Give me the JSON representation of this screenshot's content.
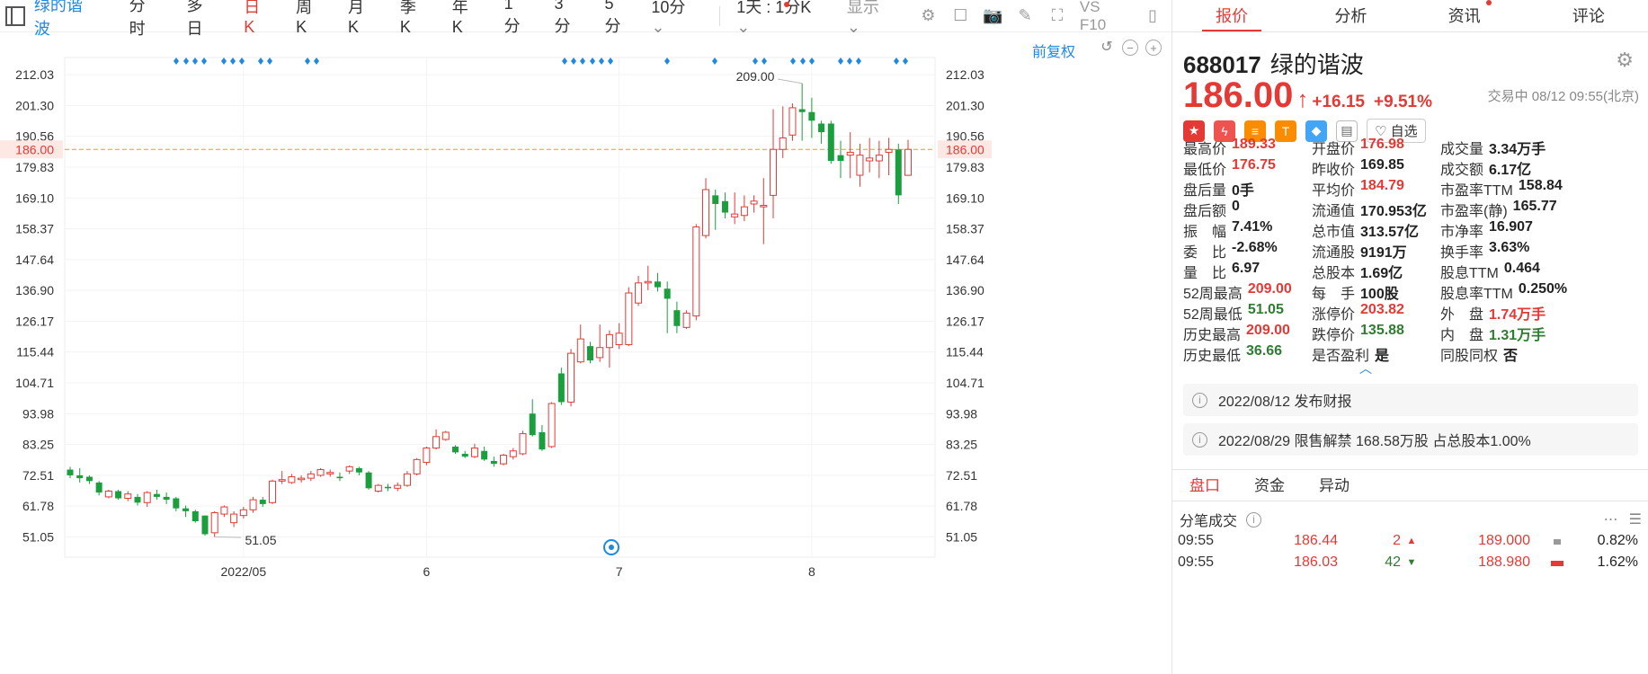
{
  "toolbar": {
    "stock_name": "绿的谐波",
    "tabs": [
      "分时",
      "多日",
      "日K",
      "周K",
      "月K",
      "季K",
      "年K",
      "1分",
      "3分",
      "5分",
      "10分"
    ],
    "active_tab": "日K",
    "period_dropdown": "1天 : 1分K",
    "display_dropdown": "显示",
    "f10_label": "VS F10"
  },
  "chart_controls": {
    "restore": "前复权"
  },
  "chart_data": {
    "type": "candlestick",
    "y_ticks": [
      "212.03",
      "201.30",
      "190.56",
      "179.83",
      "169.10",
      "158.37",
      "147.64",
      "136.90",
      "126.17",
      "115.44",
      "104.71",
      "93.98",
      "83.25",
      "72.51",
      "61.78",
      "51.05"
    ],
    "ylim": [
      44,
      218
    ],
    "x_ticks": [
      {
        "label": "2022/05",
        "index": 18
      },
      {
        "label": "6",
        "index": 37
      },
      {
        "label": "7",
        "index": 57
      },
      {
        "label": "8",
        "index": 77
      }
    ],
    "current_price": 186.0,
    "high_annotation": {
      "label": "209.00",
      "index": 76
    },
    "low_annotation": {
      "label": "51.05",
      "index": 15
    },
    "candles": [
      {
        "o": 74.5,
        "c": 72.5,
        "h": 75.5,
        "l": 71.5
      },
      {
        "o": 72.5,
        "c": 71.5,
        "h": 75.0,
        "l": 70.0
      },
      {
        "o": 72.0,
        "c": 70.5,
        "h": 72.5,
        "l": 69.5
      },
      {
        "o": 70.0,
        "c": 66.5,
        "h": 70.5,
        "l": 65.5
      },
      {
        "o": 65.0,
        "c": 67.0,
        "h": 67.5,
        "l": 64.5
      },
      {
        "o": 67.0,
        "c": 64.5,
        "h": 67.5,
        "l": 64.0
      },
      {
        "o": 64.5,
        "c": 66.0,
        "h": 67.0,
        "l": 63.5
      },
      {
        "o": 65.0,
        "c": 63.0,
        "h": 66.0,
        "l": 62.0
      },
      {
        "o": 63.0,
        "c": 66.5,
        "h": 67.0,
        "l": 61.5
      },
      {
        "o": 66.0,
        "c": 65.0,
        "h": 67.5,
        "l": 64.0
      },
      {
        "o": 65.0,
        "c": 64.0,
        "h": 66.5,
        "l": 62.5
      },
      {
        "o": 64.5,
        "c": 61.0,
        "h": 65.0,
        "l": 60.0
      },
      {
        "o": 61.0,
        "c": 60.0,
        "h": 62.0,
        "l": 58.0
      },
      {
        "o": 60.0,
        "c": 56.5,
        "h": 60.5,
        "l": 56.0
      },
      {
        "o": 58.5,
        "c": 52.0,
        "h": 58.5,
        "l": 51.5
      },
      {
        "o": 52.5,
        "c": 59.5,
        "h": 60.0,
        "l": 51.05
      },
      {
        "o": 59.0,
        "c": 61.5,
        "h": 62.0,
        "l": 58.0
      },
      {
        "o": 56.0,
        "c": 59.0,
        "h": 60.0,
        "l": 54.5
      },
      {
        "o": 58.5,
        "c": 60.5,
        "h": 61.5,
        "l": 57.5
      },
      {
        "o": 60.5,
        "c": 64.0,
        "h": 65.0,
        "l": 59.5
      },
      {
        "o": 64.0,
        "c": 62.5,
        "h": 65.0,
        "l": 61.5
      },
      {
        "o": 63.0,
        "c": 70.5,
        "h": 71.0,
        "l": 62.5
      },
      {
        "o": 70.5,
        "c": 71.0,
        "h": 74.0,
        "l": 69.5
      },
      {
        "o": 70.0,
        "c": 72.0,
        "h": 73.0,
        "l": 69.5
      },
      {
        "o": 71.0,
        "c": 71.5,
        "h": 72.5,
        "l": 70.0
      },
      {
        "o": 71.5,
        "c": 73.0,
        "h": 74.0,
        "l": 70.5
      },
      {
        "o": 72.5,
        "c": 74.5,
        "h": 75.0,
        "l": 72.0
      },
      {
        "o": 73.0,
        "c": 73.5,
        "h": 74.5,
        "l": 72.0
      },
      {
        "o": 72.0,
        "c": 71.5,
        "h": 73.5,
        "l": 70.5
      },
      {
        "o": 74.0,
        "c": 75.5,
        "h": 76.0,
        "l": 73.0
      },
      {
        "o": 75.0,
        "c": 73.5,
        "h": 75.5,
        "l": 72.5
      },
      {
        "o": 73.5,
        "c": 68.0,
        "h": 74.0,
        "l": 67.5
      },
      {
        "o": 67.0,
        "c": 69.0,
        "h": 69.5,
        "l": 66.5
      },
      {
        "o": 68.5,
        "c": 68.0,
        "h": 69.5,
        "l": 67.0
      },
      {
        "o": 68.0,
        "c": 69.0,
        "h": 70.0,
        "l": 67.0
      },
      {
        "o": 69.0,
        "c": 73.0,
        "h": 74.0,
        "l": 68.5
      },
      {
        "o": 73.0,
        "c": 78.0,
        "h": 78.5,
        "l": 72.5
      },
      {
        "o": 77.0,
        "c": 82.0,
        "h": 82.5,
        "l": 76.0
      },
      {
        "o": 82.0,
        "c": 86.0,
        "h": 88.5,
        "l": 81.5
      },
      {
        "o": 85.0,
        "c": 87.5,
        "h": 88.0,
        "l": 84.5
      },
      {
        "o": 82.5,
        "c": 80.5,
        "h": 83.0,
        "l": 80.0
      },
      {
        "o": 80.0,
        "c": 79.0,
        "h": 81.0,
        "l": 78.5
      },
      {
        "o": 79.0,
        "c": 82.0,
        "h": 83.5,
        "l": 78.5
      },
      {
        "o": 81.0,
        "c": 78.0,
        "h": 82.5,
        "l": 77.5
      },
      {
        "o": 77.5,
        "c": 76.5,
        "h": 79.0,
        "l": 75.5
      },
      {
        "o": 76.5,
        "c": 79.5,
        "h": 80.0,
        "l": 76.0
      },
      {
        "o": 79.0,
        "c": 81.0,
        "h": 82.0,
        "l": 78.0
      },
      {
        "o": 80.0,
        "c": 87.0,
        "h": 88.0,
        "l": 79.5
      },
      {
        "o": 94.0,
        "c": 86.5,
        "h": 99.0,
        "l": 86.0
      },
      {
        "o": 87.5,
        "c": 81.5,
        "h": 90.0,
        "l": 81.0
      },
      {
        "o": 82.5,
        "c": 97.5,
        "h": 98.0,
        "l": 82.0
      },
      {
        "o": 108.0,
        "c": 98.0,
        "h": 110.0,
        "l": 97.0
      },
      {
        "o": 98.0,
        "c": 115.0,
        "h": 116.5,
        "l": 96.5
      },
      {
        "o": 112.0,
        "c": 120.0,
        "h": 125.0,
        "l": 111.5
      },
      {
        "o": 117.5,
        "c": 112.5,
        "h": 119.0,
        "l": 111.5
      },
      {
        "o": 113.5,
        "c": 117.0,
        "h": 125.0,
        "l": 112.0
      },
      {
        "o": 117.0,
        "c": 121.5,
        "h": 123.0,
        "l": 110.0
      },
      {
        "o": 118.0,
        "c": 122.0,
        "h": 125.5,
        "l": 116.5
      },
      {
        "o": 118.0,
        "c": 136.0,
        "h": 138.0,
        "l": 117.5
      },
      {
        "o": 132.5,
        "c": 139.5,
        "h": 142.0,
        "l": 131.5
      },
      {
        "o": 139.5,
        "c": 140.0,
        "h": 145.5,
        "l": 137.0
      },
      {
        "o": 140.0,
        "c": 138.0,
        "h": 143.0,
        "l": 136.5
      },
      {
        "o": 137.5,
        "c": 134.0,
        "h": 140.0,
        "l": 122.0
      },
      {
        "o": 130.0,
        "c": 124.5,
        "h": 133.0,
        "l": 122.0
      },
      {
        "o": 124.0,
        "c": 129.0,
        "h": 130.0,
        "l": 123.5
      },
      {
        "o": 128.0,
        "c": 159.0,
        "h": 160.0,
        "l": 126.5
      },
      {
        "o": 156.0,
        "c": 172.0,
        "h": 176.0,
        "l": 155.0
      },
      {
        "o": 170.0,
        "c": 167.0,
        "h": 172.0,
        "l": 158.0
      },
      {
        "o": 168.0,
        "c": 164.0,
        "h": 171.0,
        "l": 162.0
      },
      {
        "o": 162.5,
        "c": 163.5,
        "h": 171.0,
        "l": 160.0
      },
      {
        "o": 163.0,
        "c": 166.0,
        "h": 170.0,
        "l": 161.0
      },
      {
        "o": 167.0,
        "c": 168.0,
        "h": 170.0,
        "l": 164.0
      },
      {
        "o": 166.0,
        "c": 166.5,
        "h": 176.0,
        "l": 153.0
      },
      {
        "o": 170.0,
        "c": 186.0,
        "h": 200.0,
        "l": 162.0
      },
      {
        "o": 186.0,
        "c": 190.0,
        "h": 201.0,
        "l": 183.0
      },
      {
        "o": 191.0,
        "c": 200.5,
        "h": 202.0,
        "l": 189.0
      },
      {
        "o": 200.0,
        "c": 199.0,
        "h": 209.0,
        "l": 189.0
      },
      {
        "o": 199.0,
        "c": 196.0,
        "h": 204.0,
        "l": 190.0
      },
      {
        "o": 195.0,
        "c": 192.0,
        "h": 196.0,
        "l": 188.0
      },
      {
        "o": 195.0,
        "c": 182.0,
        "h": 196.0,
        "l": 181.0
      },
      {
        "o": 184.0,
        "c": 182.0,
        "h": 189.0,
        "l": 176.0
      },
      {
        "o": 184.0,
        "c": 185.0,
        "h": 192.0,
        "l": 176.0
      },
      {
        "o": 177.0,
        "c": 184.0,
        "h": 188.0,
        "l": 173.0
      },
      {
        "o": 182.0,
        "c": 183.0,
        "h": 190.0,
        "l": 178.0
      },
      {
        "o": 182.0,
        "c": 184.0,
        "h": 189.0,
        "l": 176.0
      },
      {
        "o": 185.0,
        "c": 186.0,
        "h": 190.0,
        "l": 177.0
      },
      {
        "o": 186.0,
        "c": 170.0,
        "h": 188.0,
        "l": 167.0
      },
      {
        "o": 176.98,
        "c": 186.0,
        "h": 189.33,
        "l": 176.75
      }
    ]
  },
  "panel": {
    "tabs": [
      "报价",
      "分析",
      "资讯",
      "评论"
    ],
    "code": "688017",
    "name": "绿的谐波",
    "price": "186.00",
    "change": "+16.15",
    "change_pct": "+9.51%",
    "status": "交易中 08/12 09:55(北京)",
    "zixuan": "自选",
    "quick_trade": "快捷交易",
    "grid": [
      [
        [
          "最高价",
          "189.33",
          "up"
        ],
        [
          "开盘价",
          "176.98",
          "up"
        ],
        [
          "成交量",
          "3.34万手",
          "flat"
        ]
      ],
      [
        [
          "最低价",
          "176.75",
          "up"
        ],
        [
          "昨收价",
          "169.85",
          "flat"
        ],
        [
          "成交额",
          "6.17亿",
          "flat"
        ]
      ],
      [
        [
          "盘后量",
          "0手",
          "flat"
        ],
        [
          "平均价",
          "184.79",
          "up"
        ],
        [
          "市盈率TTM",
          "158.84",
          "flat"
        ]
      ],
      [
        [
          "盘后额",
          "0",
          "flat"
        ],
        [
          "流通值",
          "170.953亿",
          "flat"
        ],
        [
          "市盈率(静)",
          "165.77",
          "flat"
        ]
      ],
      [
        [
          "振　幅",
          "7.41%",
          "flat"
        ],
        [
          "总市值",
          "313.57亿",
          "flat"
        ],
        [
          "市净率",
          "16.907",
          "flat"
        ]
      ],
      [
        [
          "委　比",
          "-2.68%",
          "flat"
        ],
        [
          "流通股",
          "9191万",
          "flat"
        ],
        [
          "换手率",
          "3.63%",
          "flat"
        ]
      ],
      [
        [
          "量　比",
          "6.97",
          "flat"
        ],
        [
          "总股本",
          "1.69亿",
          "flat"
        ],
        [
          "股息TTM",
          "0.464",
          "flat"
        ]
      ],
      [
        [
          "52周最高",
          "209.00",
          "up"
        ],
        [
          "每　手",
          "100股",
          "flat"
        ],
        [
          "股息率TTM",
          "0.250%",
          "flat"
        ]
      ],
      [
        [
          "52周最低",
          "51.05",
          "dn"
        ],
        [
          "涨停价",
          "203.82",
          "up"
        ],
        [
          "外　盘",
          "1.74万手",
          "up"
        ]
      ],
      [
        [
          "历史最高",
          "209.00",
          "up"
        ],
        [
          "跌停价",
          "135.88",
          "dn"
        ],
        [
          "内　盘",
          "1.31万手",
          "dn"
        ]
      ],
      [
        [
          "历史最低",
          "36.66",
          "dn"
        ],
        [
          "是否盈利",
          "是",
          "flat"
        ],
        [
          "同股同权",
          "否",
          "flat"
        ]
      ]
    ],
    "notices": [
      "2022/08/12  发布财报",
      "2022/08/29  限售解禁 168.58万股 占总股本1.00%"
    ],
    "bottom_tabs": [
      "盘口",
      "资金",
      "异动"
    ],
    "fenbi_title": "分笔成交",
    "trades": [
      {
        "time": "09:55",
        "price": "186.44",
        "vol": "2",
        "dir": "up",
        "p2": "189.000",
        "pct": "0.82%"
      },
      {
        "time": "09:55",
        "price": "186.03",
        "vol": "42",
        "dir": "dn",
        "p2": "188.980",
        "pct": "1.62%"
      }
    ]
  }
}
